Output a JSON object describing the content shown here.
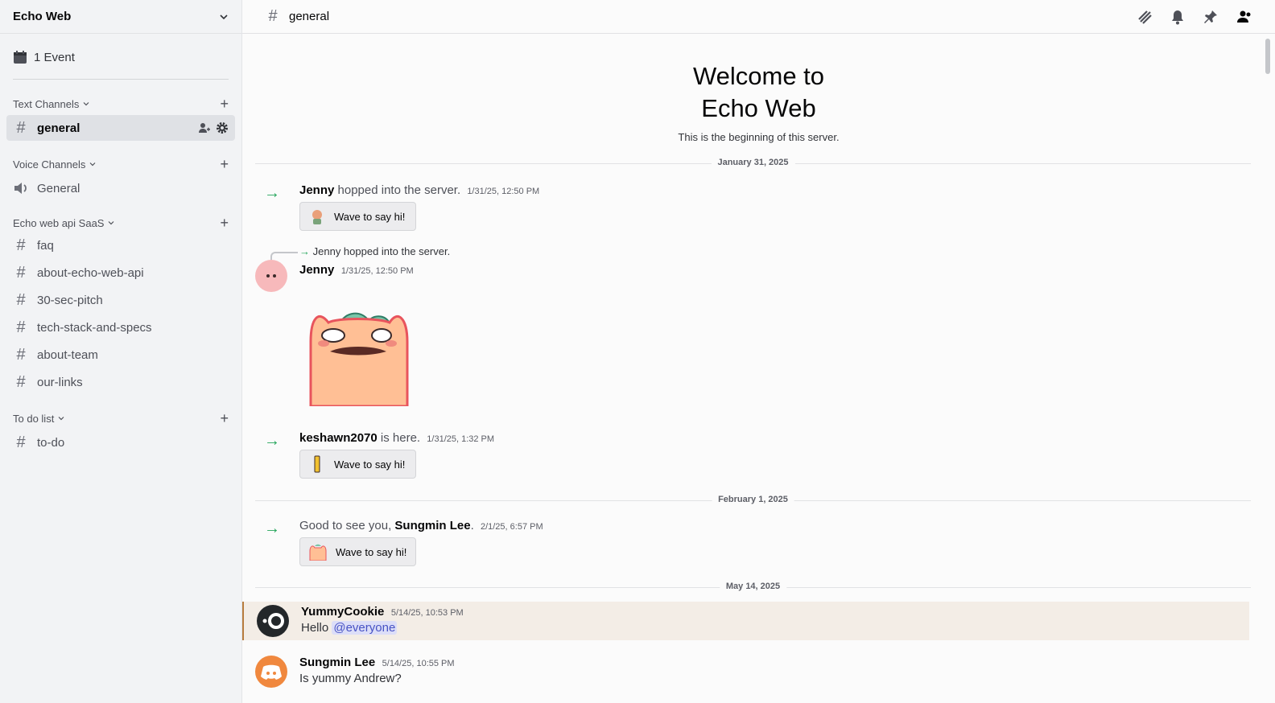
{
  "server": {
    "name": "Echo Web"
  },
  "events": {
    "label": "1 Event"
  },
  "categories": [
    {
      "name": "Text Channels",
      "channels": [
        "general"
      ]
    },
    {
      "name": "Voice Channels",
      "channels": [
        "General"
      ]
    },
    {
      "name": "Echo web api SaaS",
      "channels": [
        "faq",
        "about-echo-web-api",
        "30-sec-pitch",
        "tech-stack-and-specs",
        "about-team",
        "our-links"
      ]
    },
    {
      "name": "To do list",
      "channels": [
        "to-do"
      ]
    }
  ],
  "topbar": {
    "channel": "general"
  },
  "welcome": {
    "line1": "Welcome to",
    "line2": "Echo Web",
    "subtitle": "This is the beginning of this server."
  },
  "dates": [
    "January 31, 2025",
    "February 1, 2025",
    "May 14, 2025"
  ],
  "messages": {
    "join1": {
      "user": "Jenny",
      "text": "hopped into the server.",
      "time": "1/31/25, 12:50 PM",
      "wave": "Wave to say hi!"
    },
    "reply": {
      "ref": "Jenny hopped into the server.",
      "user": "Jenny",
      "time": "1/31/25, 12:50 PM"
    },
    "join2": {
      "user": "keshawn2070",
      "text": "is here.",
      "time": "1/31/25, 1:32 PM",
      "wave": "Wave to say hi!"
    },
    "join3": {
      "prefix": "Good to see you,",
      "user": "Sungmin Lee",
      "suffix": ".",
      "time": "2/1/25, 6:57 PM",
      "wave": "Wave to say hi!"
    },
    "m1": {
      "user": "YummyCookie",
      "time": "5/14/25, 10:53 PM",
      "text": "Hello",
      "mention": "@everyone"
    },
    "m2": {
      "user": "Sungmin Lee",
      "time": "5/14/25, 10:55 PM",
      "text": "Is yummy Andrew?"
    }
  },
  "colors": {
    "join_arrow": "#23a55a",
    "mention_bg": "#dcdef8",
    "highlight_bg": "#f3ede6",
    "avatar_orange": "#f0883e"
  }
}
